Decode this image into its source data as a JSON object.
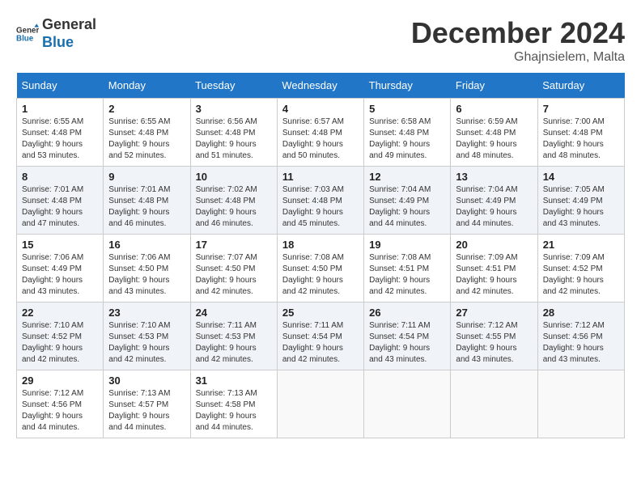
{
  "header": {
    "logo_line1": "General",
    "logo_line2": "Blue",
    "month_year": "December 2024",
    "location": "Ghajnsielem, Malta"
  },
  "weekdays": [
    "Sunday",
    "Monday",
    "Tuesday",
    "Wednesday",
    "Thursday",
    "Friday",
    "Saturday"
  ],
  "weeks": [
    [
      {
        "day": "1",
        "info": "Sunrise: 6:55 AM\nSunset: 4:48 PM\nDaylight: 9 hours\nand 53 minutes."
      },
      {
        "day": "2",
        "info": "Sunrise: 6:55 AM\nSunset: 4:48 PM\nDaylight: 9 hours\nand 52 minutes."
      },
      {
        "day": "3",
        "info": "Sunrise: 6:56 AM\nSunset: 4:48 PM\nDaylight: 9 hours\nand 51 minutes."
      },
      {
        "day": "4",
        "info": "Sunrise: 6:57 AM\nSunset: 4:48 PM\nDaylight: 9 hours\nand 50 minutes."
      },
      {
        "day": "5",
        "info": "Sunrise: 6:58 AM\nSunset: 4:48 PM\nDaylight: 9 hours\nand 49 minutes."
      },
      {
        "day": "6",
        "info": "Sunrise: 6:59 AM\nSunset: 4:48 PM\nDaylight: 9 hours\nand 48 minutes."
      },
      {
        "day": "7",
        "info": "Sunrise: 7:00 AM\nSunset: 4:48 PM\nDaylight: 9 hours\nand 48 minutes."
      }
    ],
    [
      {
        "day": "8",
        "info": "Sunrise: 7:01 AM\nSunset: 4:48 PM\nDaylight: 9 hours\nand 47 minutes."
      },
      {
        "day": "9",
        "info": "Sunrise: 7:01 AM\nSunset: 4:48 PM\nDaylight: 9 hours\nand 46 minutes."
      },
      {
        "day": "10",
        "info": "Sunrise: 7:02 AM\nSunset: 4:48 PM\nDaylight: 9 hours\nand 46 minutes."
      },
      {
        "day": "11",
        "info": "Sunrise: 7:03 AM\nSunset: 4:48 PM\nDaylight: 9 hours\nand 45 minutes."
      },
      {
        "day": "12",
        "info": "Sunrise: 7:04 AM\nSunset: 4:49 PM\nDaylight: 9 hours\nand 44 minutes."
      },
      {
        "day": "13",
        "info": "Sunrise: 7:04 AM\nSunset: 4:49 PM\nDaylight: 9 hours\nand 44 minutes."
      },
      {
        "day": "14",
        "info": "Sunrise: 7:05 AM\nSunset: 4:49 PM\nDaylight: 9 hours\nand 43 minutes."
      }
    ],
    [
      {
        "day": "15",
        "info": "Sunrise: 7:06 AM\nSunset: 4:49 PM\nDaylight: 9 hours\nand 43 minutes."
      },
      {
        "day": "16",
        "info": "Sunrise: 7:06 AM\nSunset: 4:50 PM\nDaylight: 9 hours\nand 43 minutes."
      },
      {
        "day": "17",
        "info": "Sunrise: 7:07 AM\nSunset: 4:50 PM\nDaylight: 9 hours\nand 42 minutes."
      },
      {
        "day": "18",
        "info": "Sunrise: 7:08 AM\nSunset: 4:50 PM\nDaylight: 9 hours\nand 42 minutes."
      },
      {
        "day": "19",
        "info": "Sunrise: 7:08 AM\nSunset: 4:51 PM\nDaylight: 9 hours\nand 42 minutes."
      },
      {
        "day": "20",
        "info": "Sunrise: 7:09 AM\nSunset: 4:51 PM\nDaylight: 9 hours\nand 42 minutes."
      },
      {
        "day": "21",
        "info": "Sunrise: 7:09 AM\nSunset: 4:52 PM\nDaylight: 9 hours\nand 42 minutes."
      }
    ],
    [
      {
        "day": "22",
        "info": "Sunrise: 7:10 AM\nSunset: 4:52 PM\nDaylight: 9 hours\nand 42 minutes."
      },
      {
        "day": "23",
        "info": "Sunrise: 7:10 AM\nSunset: 4:53 PM\nDaylight: 9 hours\nand 42 minutes."
      },
      {
        "day": "24",
        "info": "Sunrise: 7:11 AM\nSunset: 4:53 PM\nDaylight: 9 hours\nand 42 minutes."
      },
      {
        "day": "25",
        "info": "Sunrise: 7:11 AM\nSunset: 4:54 PM\nDaylight: 9 hours\nand 42 minutes."
      },
      {
        "day": "26",
        "info": "Sunrise: 7:11 AM\nSunset: 4:54 PM\nDaylight: 9 hours\nand 43 minutes."
      },
      {
        "day": "27",
        "info": "Sunrise: 7:12 AM\nSunset: 4:55 PM\nDaylight: 9 hours\nand 43 minutes."
      },
      {
        "day": "28",
        "info": "Sunrise: 7:12 AM\nSunset: 4:56 PM\nDaylight: 9 hours\nand 43 minutes."
      }
    ],
    [
      {
        "day": "29",
        "info": "Sunrise: 7:12 AM\nSunset: 4:56 PM\nDaylight: 9 hours\nand 44 minutes."
      },
      {
        "day": "30",
        "info": "Sunrise: 7:13 AM\nSunset: 4:57 PM\nDaylight: 9 hours\nand 44 minutes."
      },
      {
        "day": "31",
        "info": "Sunrise: 7:13 AM\nSunset: 4:58 PM\nDaylight: 9 hours\nand 44 minutes."
      },
      {
        "day": "",
        "info": ""
      },
      {
        "day": "",
        "info": ""
      },
      {
        "day": "",
        "info": ""
      },
      {
        "day": "",
        "info": ""
      }
    ]
  ]
}
